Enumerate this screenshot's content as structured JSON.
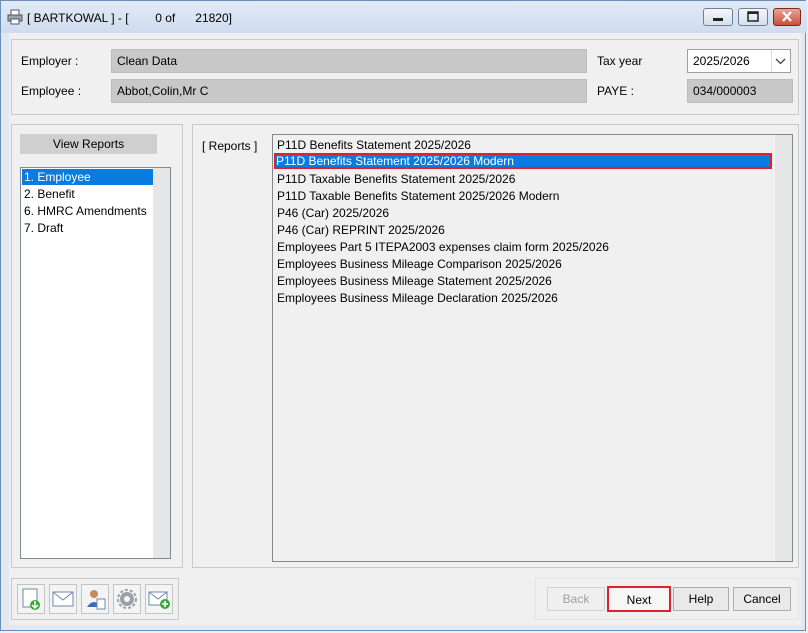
{
  "window": {
    "title": "[ BARTKOWAL ] - [        0 of      21820]"
  },
  "header": {
    "employer_label": "Employer :",
    "employer_value": "Clean Data",
    "employee_label": "Employee :",
    "employee_value": "Abbot,Colin,Mr C",
    "tax_year_label": "Tax year",
    "tax_year_value": "2025/2026",
    "paye_label": "PAYE :",
    "paye_value": "034/000003"
  },
  "view_reports": {
    "title": "View Reports",
    "items": [
      "1. Employee",
      "2. Benefit",
      "6. HMRC Amendments",
      "7. Draft"
    ],
    "selected_index": 0
  },
  "reports": {
    "label": "[ Reports ]",
    "items": [
      "P11D Benefits Statement 2025/2026",
      "P11D Benefits Statement 2025/2026 Modern",
      "P11D Taxable Benefits Statement 2025/2026",
      "P11D Taxable Benefits Statement 2025/2026 Modern",
      "P46 (Car) 2025/2026",
      "P46 (Car) REPRINT 2025/2026",
      "Employees Part 5 ITEPA2003 expenses claim form 2025/2026",
      "Employees Business Mileage Comparison 2025/2026",
      "Employees Business Mileage Statement 2025/2026",
      "Employees Business Mileage Declaration 2025/2026"
    ],
    "selected_index": 1
  },
  "toolbar": {
    "icons": [
      "export-icon",
      "email-icon",
      "user-report-icon",
      "settings-icon",
      "email-add-icon"
    ]
  },
  "buttons": {
    "back": "Back",
    "next": "Next",
    "help": "Help",
    "cancel": "Cancel"
  },
  "colors": {
    "selection": "#0a7be0",
    "highlight_border": "#e0202a"
  }
}
